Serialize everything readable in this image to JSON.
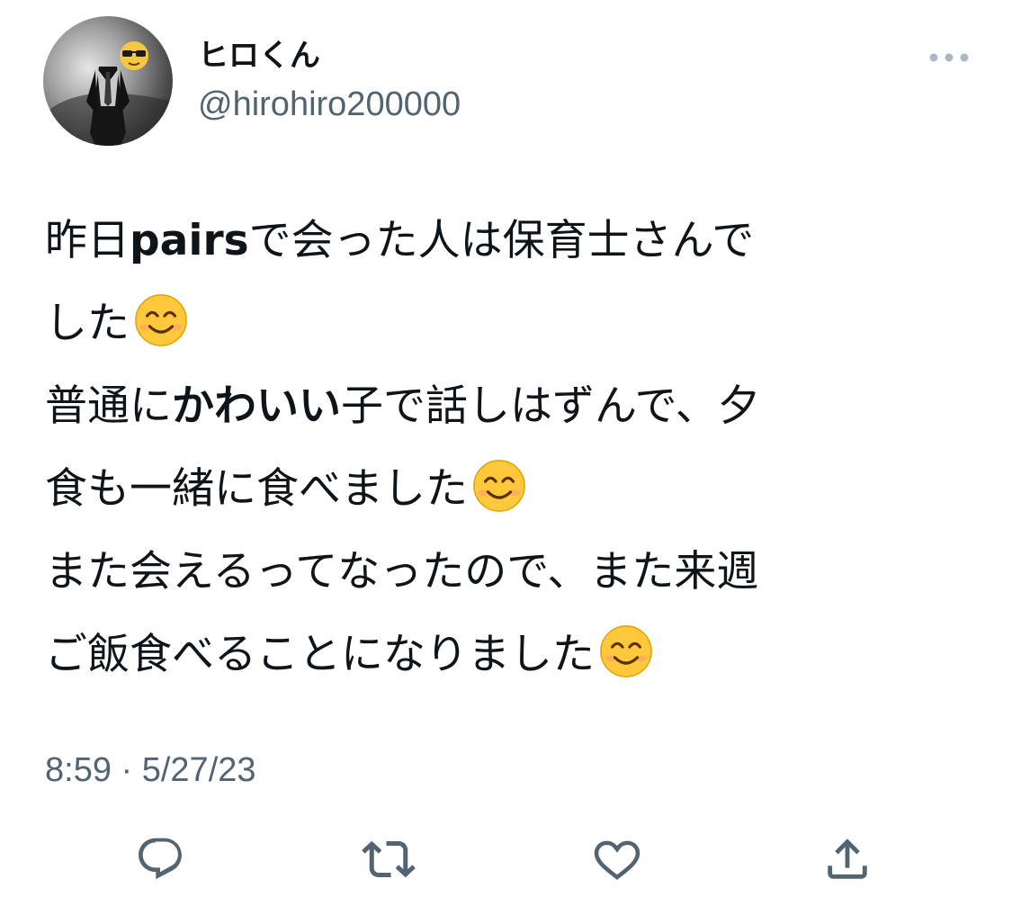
{
  "user": {
    "display_name": "ヒロくん",
    "handle": "@hirohiro200000",
    "avatar_icon": "sunglasses-suit-avatar"
  },
  "header": {
    "more_icon": "more-dots-icon"
  },
  "tweet": {
    "lines": [
      [
        {
          "text": "昨日",
          "bold": false
        },
        {
          "text": "pairs",
          "bold": true
        },
        {
          "text": "で会った人は保育士さんで",
          "bold": false
        }
      ],
      [
        {
          "text": "した",
          "bold": false
        },
        {
          "emoji": "smiling-face"
        }
      ],
      [
        {
          "text": "普通に",
          "bold": false
        },
        {
          "text": "かわいい",
          "bold": true
        },
        {
          "text": "子で話しはずんで、夕",
          "bold": false
        }
      ],
      [
        {
          "text": "食も一緒に食べました",
          "bold": false
        },
        {
          "emoji": "smiling-face"
        }
      ],
      [
        {
          "text": "また会えるってなったので、また来週",
          "bold": false
        }
      ],
      [
        {
          "text": "ご飯食べることになりました",
          "bold": false
        },
        {
          "emoji": "smiling-face"
        }
      ]
    ],
    "timestamp": "8:59 · 5/27/23"
  },
  "actions": [
    {
      "name": "reply",
      "icon": "reply-icon"
    },
    {
      "name": "retweet",
      "icon": "retweet-icon"
    },
    {
      "name": "like",
      "icon": "heart-icon"
    },
    {
      "name": "share",
      "icon": "share-icon"
    }
  ],
  "colors": {
    "text_primary": "#0f1419",
    "text_secondary": "#536471",
    "icon_gray": "#536471",
    "more_gray": "#aab8c2",
    "emoji_face": "#ffc83d"
  }
}
